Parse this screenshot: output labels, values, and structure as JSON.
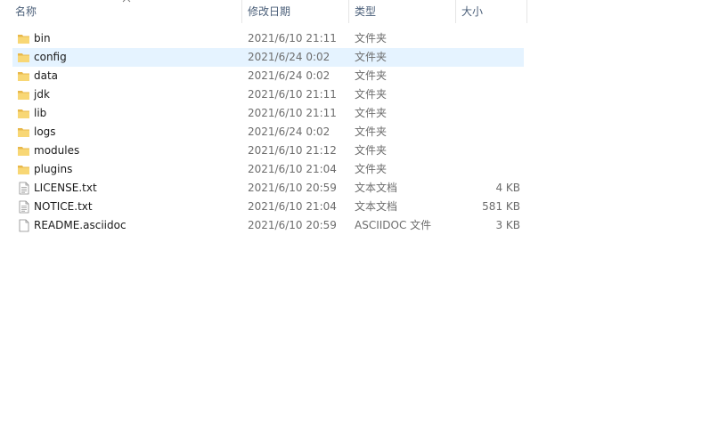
{
  "columns": {
    "name": "名称",
    "date": "修改日期",
    "type": "类型",
    "size": "大小"
  },
  "colors": {
    "folder": "#f8d775",
    "folder_dark": "#e8b84a",
    "selection": "#e5f3ff",
    "header_text": "#4c607a"
  },
  "files": [
    {
      "name": "bin",
      "date": "2021/6/10 21:11",
      "type": "文件夹",
      "size": "",
      "icon": "folder-icon"
    },
    {
      "name": "config",
      "date": "2021/6/24 0:02",
      "type": "文件夹",
      "size": "",
      "icon": "folder-icon",
      "selected": true
    },
    {
      "name": "data",
      "date": "2021/6/24 0:02",
      "type": "文件夹",
      "size": "",
      "icon": "folder-icon"
    },
    {
      "name": "jdk",
      "date": "2021/6/10 21:11",
      "type": "文件夹",
      "size": "",
      "icon": "folder-icon"
    },
    {
      "name": "lib",
      "date": "2021/6/10 21:11",
      "type": "文件夹",
      "size": "",
      "icon": "folder-icon"
    },
    {
      "name": "logs",
      "date": "2021/6/24 0:02",
      "type": "文件夹",
      "size": "",
      "icon": "folder-icon"
    },
    {
      "name": "modules",
      "date": "2021/6/10 21:12",
      "type": "文件夹",
      "size": "",
      "icon": "folder-icon"
    },
    {
      "name": "plugins",
      "date": "2021/6/10 21:04",
      "type": "文件夹",
      "size": "",
      "icon": "folder-icon"
    },
    {
      "name": "LICENSE.txt",
      "date": "2021/6/10 20:59",
      "type": "文本文档",
      "size": "4 KB",
      "icon": "text-document-icon"
    },
    {
      "name": "NOTICE.txt",
      "date": "2021/6/10 21:04",
      "type": "文本文档",
      "size": "581 KB",
      "icon": "text-document-icon"
    },
    {
      "name": "README.asciidoc",
      "date": "2021/6/10 20:59",
      "type": "ASCIIDOC 文件",
      "size": "3 KB",
      "icon": "blank-file-icon"
    }
  ]
}
